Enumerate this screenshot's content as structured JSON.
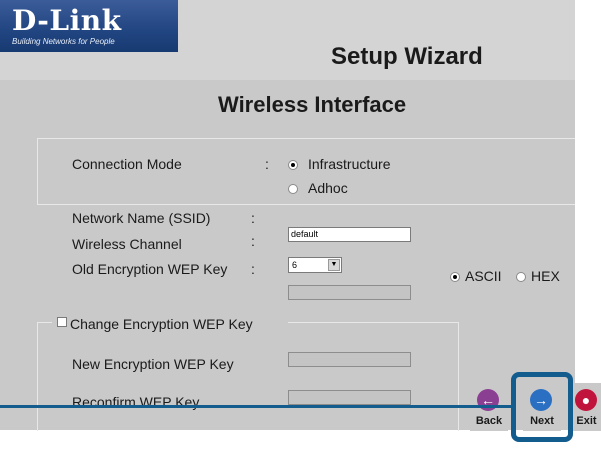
{
  "header": {
    "logo": "D-Link",
    "tagline": "Building Networks for People",
    "setup_title": "Setup Wizard"
  },
  "page_title": "Wireless Interface",
  "connection_mode": {
    "label": "Connection Mode",
    "colon": ":",
    "options": [
      {
        "label": "Infrastructure",
        "selected": true
      },
      {
        "label": "Adhoc",
        "selected": false
      }
    ]
  },
  "fields": {
    "ssid_label": "Network Name (SSID)",
    "ssid_colon": ":",
    "ssid_value": "default",
    "channel_label": "Wireless Channel",
    "channel_colon": ":",
    "channel_value": "6",
    "old_wep_label": "Old Encryption WEP Key",
    "old_wep_colon": ":"
  },
  "key_format": {
    "options": [
      {
        "label": "ASCII",
        "selected": true
      },
      {
        "label": "HEX",
        "selected": false
      }
    ]
  },
  "change_wep": {
    "checkbox_label": "Change Encryption WEP Key",
    "checked": false,
    "new_label": "New Encryption WEP Key",
    "confirm_label": "Reconfirm WEP Key"
  },
  "buttons": {
    "back": "Back",
    "next": "Next",
    "exit": "Exit"
  },
  "colors": {
    "logo_bg": "#214581",
    "highlight": "#135c8e",
    "window_bg": "#c9c9c9"
  }
}
